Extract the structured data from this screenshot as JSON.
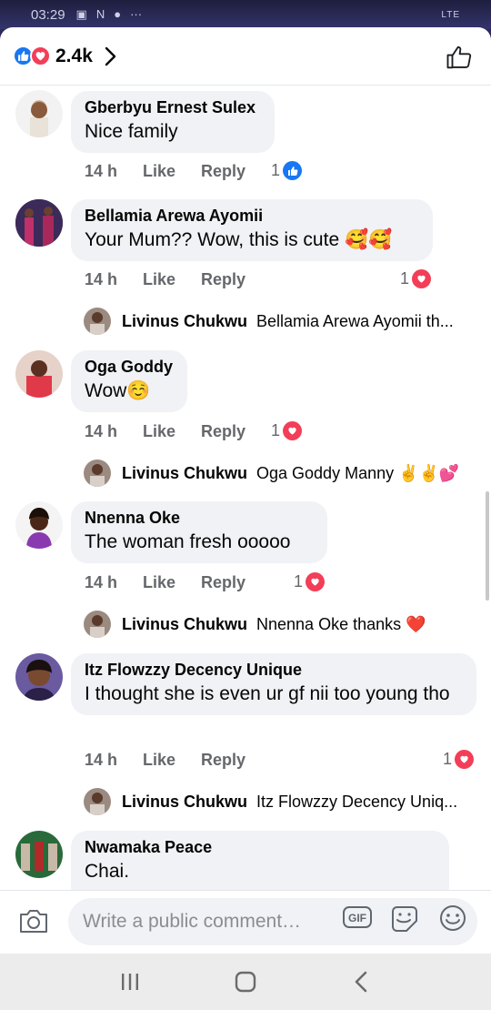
{
  "status_bar": {
    "time": "03:29",
    "icons": [
      "image-icon",
      "n-icon",
      "bag-icon",
      "more-icon"
    ],
    "network": "LTE"
  },
  "header": {
    "reaction_count": "2.4k",
    "reactions": [
      "like",
      "love"
    ]
  },
  "comments": [
    {
      "author": "Gberbyu Ernest Sulex",
      "text": "Nice family",
      "time": "14 h",
      "like_label": "Like",
      "reply_label": "Reply",
      "reaction_count": "1",
      "reaction": "like"
    },
    {
      "author": "Bellamia Arewa Ayomii",
      "text": "Your Mum?? Wow, this is cute 🥰🥰",
      "time": "14 h",
      "like_label": "Like",
      "reply_label": "Reply",
      "reaction_count": "1",
      "reaction": "love",
      "reply": {
        "author": "Livinus Chukwu",
        "text": "Bellamia Arewa Ayomii th..."
      }
    },
    {
      "author": "Oga Goddy",
      "text": "Wow☺️",
      "time": "14 h",
      "like_label": "Like",
      "reply_label": "Reply",
      "reaction_count": "1",
      "reaction": "love",
      "reply": {
        "author": "Livinus Chukwu",
        "text": "Oga Goddy Manny ✌️✌️💕"
      }
    },
    {
      "author": "Nnenna Oke",
      "text": "The woman fresh ooooo",
      "time": "14 h",
      "like_label": "Like",
      "reply_label": "Reply",
      "reaction_count": "1",
      "reaction": "love",
      "reply": {
        "author": "Livinus Chukwu",
        "text": "Nnenna Oke thanks ❤️"
      }
    },
    {
      "author": "Itz Flowzzy Decency Unique",
      "text": "I thought she is even ur gf nii too young tho",
      "time": "14 h",
      "like_label": "Like",
      "reply_label": "Reply",
      "reaction_count": "1",
      "reaction": "love",
      "reply": {
        "author": "Livinus Chukwu",
        "text": "Itz Flowzzy Decency Uniq..."
      }
    },
    {
      "author": "Nwamaka Peace",
      "text": "Chai."
    }
  ],
  "composer": {
    "placeholder": "Write a public comment…",
    "gif_label": "GIF"
  },
  "colors": {
    "like_blue": "#1877f2",
    "love_red": "#f33e58",
    "bubble_gray": "#f0f2f5",
    "meta_gray": "#65676b"
  }
}
